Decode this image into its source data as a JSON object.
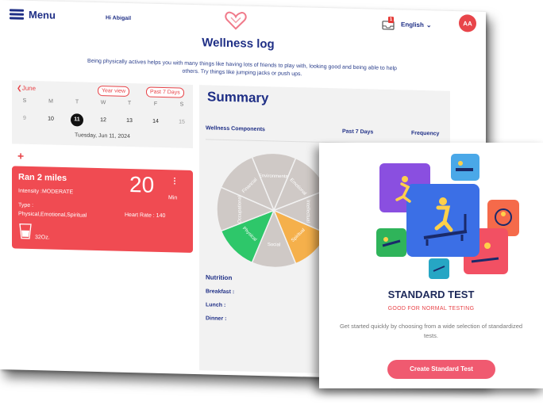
{
  "header": {
    "menu_label": "Menu",
    "greeting": "Hi Abigail",
    "notification_count": "1",
    "language": "English",
    "avatar_initials": "AA"
  },
  "page": {
    "title": "Wellness log",
    "intro": "Being physically actives helps you with many things like having lots of friends to play with, looking good and being able to help others. Try things like jumping jacks or push ups."
  },
  "calendar": {
    "prev_month": "June",
    "year_view": "Year view",
    "past_7_days": "Past 7 Days",
    "day_names": [
      "S",
      "M",
      "T",
      "W",
      "T",
      "F",
      "S"
    ],
    "dates": [
      "9",
      "10",
      "11",
      "12",
      "13",
      "14",
      "15"
    ],
    "selected_date": "Tuesday, Jun 11, 2024"
  },
  "activity": {
    "title": "Ran 2 miles",
    "intensity": "Intensity :MODERATE",
    "type_label": "Type :",
    "type_value": "Physical,Emotional,Spiritual",
    "duration": "20",
    "duration_unit": "Min",
    "heart_rate": "Heart Rate : 140",
    "water_amount": "32",
    "water_unit": "Oz."
  },
  "summary": {
    "title": "Summary",
    "col_components": "Wellness Components",
    "col_past7": "Past 7 Days",
    "col_frequency": "Frequency",
    "wheel_segments": [
      "Environmental",
      "Emotional",
      "Intellectual",
      "Spiritual",
      "Social",
      "Physical",
      "Occupational",
      "Financial"
    ],
    "highlighted": {
      "Physical": "#2ec76a",
      "Spiritual": "#f5b04b"
    },
    "nutrition_label": "Nutrition",
    "breakfast": "Breakfast :",
    "lunch": "Lunch :",
    "dinner": "Dinner :"
  },
  "standard_test": {
    "title": "STANDARD TEST",
    "subtitle": "GOOD FOR NORMAL TESTING",
    "description": "Get started quickly by choosing from a wide selection of standardized tests.",
    "button": "Create Standard Test"
  }
}
